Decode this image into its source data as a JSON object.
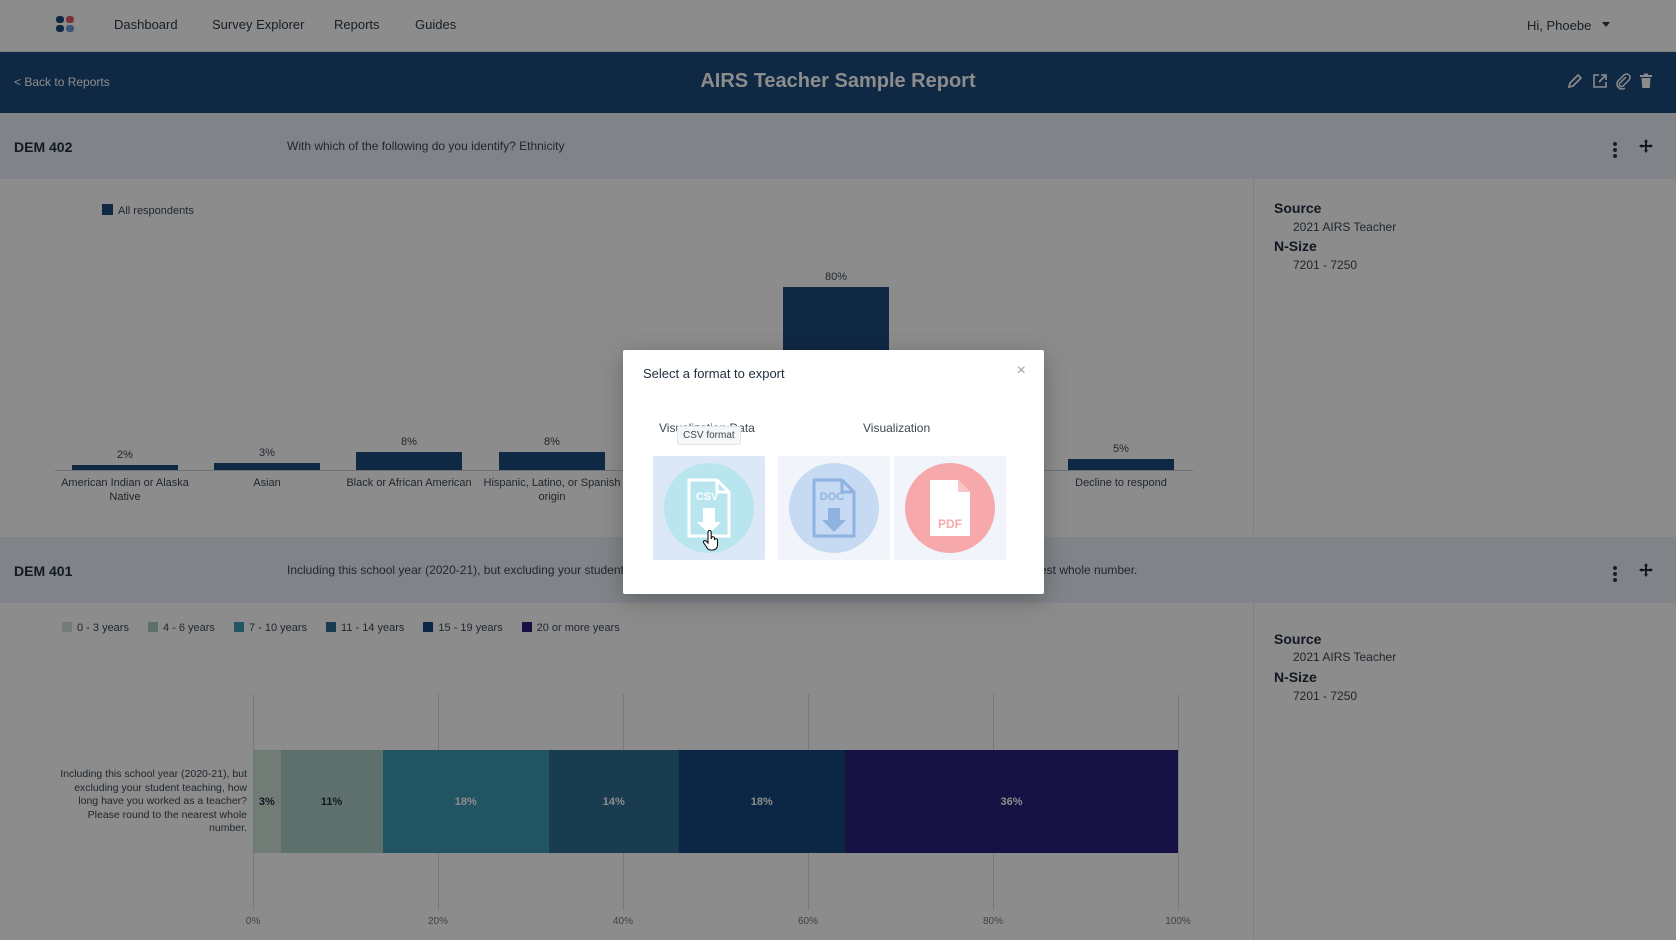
{
  "nav": {
    "links": [
      "Dashboard",
      "Survey Explorer",
      "Reports",
      "Guides"
    ],
    "user": "Hi, Phoebe"
  },
  "report": {
    "back": "< Back to Reports",
    "title": "AIRS Teacher Sample Report"
  },
  "section1": {
    "code": "DEM 402",
    "question": "With which of the following do you identify? Ethnicity",
    "legend": "All respondents",
    "source_label": "Source",
    "source": "2021 AIRS Teacher",
    "nsize_label": "N-Size",
    "nsize": "7201 - 7250"
  },
  "section2": {
    "code": "DEM 401",
    "question": "Including this school year (2020-21), but excluding your student",
    "question_tail": "est whole number.",
    "row_label": "Including this school year (2020-21), but excluding your student teaching, how long have you worked as a teacher? Please round to the nearest whole number.",
    "source_label": "Source",
    "source": "2021 AIRS Teacher",
    "nsize_label": "N-Size",
    "nsize": "7201 - 7250"
  },
  "chart_data": [
    {
      "type": "bar",
      "series": [
        {
          "name": "All respondents",
          "values": [
            2,
            3,
            8,
            8,
            80,
            5
          ]
        }
      ],
      "categories": [
        "American Indian or Alaska Native",
        "Asian",
        "Black or African American",
        "Hispanic, Latino, or Spanish origin",
        "",
        "Decline to respond"
      ],
      "labels": [
        "2%",
        "3%",
        "8%",
        "8%",
        "80%",
        "5%"
      ]
    },
    {
      "type": "bar",
      "stacked": true,
      "orientation": "horizontal",
      "series": [
        {
          "name": "0 - 3 years",
          "value": 3,
          "label": "3%",
          "color": "#cfe2d9"
        },
        {
          "name": "4 - 6 years",
          "value": 11,
          "label": "11%",
          "color": "#a9ccc4"
        },
        {
          "name": "7 - 10 years",
          "value": 18,
          "label": "18%",
          "color": "#3d9cb7"
        },
        {
          "name": "11 - 14 years",
          "value": 14,
          "label": "14%",
          "color": "#2e6d93"
        },
        {
          "name": "15 - 19 years",
          "value": 18,
          "label": "18%",
          "color": "#17477e"
        },
        {
          "name": "20 or more years",
          "value": 36,
          "label": "36%",
          "color": "#27217a"
        }
      ],
      "ticks": [
        "0%",
        "20%",
        "40%",
        "60%",
        "80%",
        "100%"
      ],
      "xlim": [
        0,
        100
      ]
    }
  ],
  "modal": {
    "title": "Select a format to export",
    "close": "×",
    "group1": "Visualization Data",
    "group2": "Visualization",
    "tooltip": "CSV format",
    "csv": "CSV",
    "doc": "DOC",
    "pdf": "PDF"
  }
}
